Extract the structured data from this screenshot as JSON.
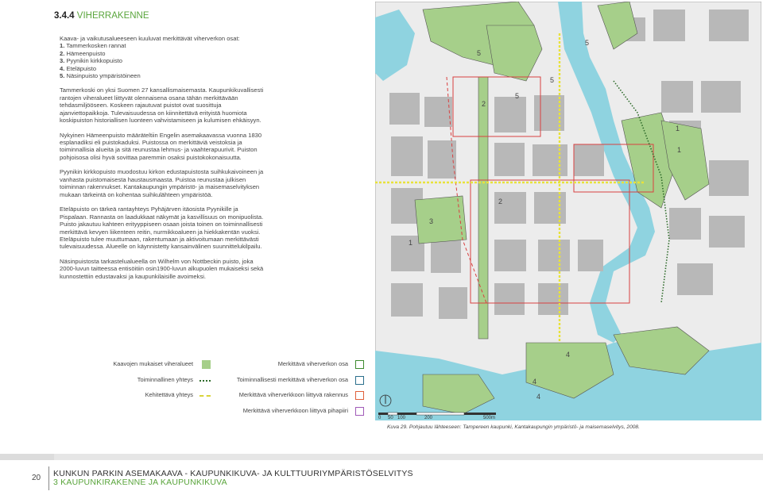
{
  "section": {
    "number": "3.4.4",
    "title": "VIHERRAKENNE"
  },
  "intro": "Kaava- ja vaikutusalueeseen kuuluvat merkittävät viherverkon osat:",
  "list": [
    {
      "num": "1.",
      "text": "Tammerkosken rannat"
    },
    {
      "num": "2.",
      "text": "Hämeenpuisto"
    },
    {
      "num": "3.",
      "text": "Pyynikin kirkkopuisto"
    },
    {
      "num": "4.",
      "text": "Eteläpuisto"
    },
    {
      "num": "5.",
      "text": "Näsinpuisto ympäristöineen"
    }
  ],
  "paragraphs": [
    "Tammerkoski on yksi Suomen 27 kansallismaisemasta. Kaupunkikuvallisesti rantojen viheralueet liittyvät olennaisena osana tähän merkittävään tehdasmiljööseen. Koskeen rajautuvat puistot ovat suosittuja ajanviettopaikkoja. Tulevaisuudessa on kiinnitettävä erityistä huomiota koskipuiston historiallisen luonteen vahvistamiseen ja kulumisen ehkäisyyn.",
    "Nykyinen Hämeenpuisto määräteltiin Engelin asemakaavassa vuonna 1830 esplanadiksi eli puistokaduksi. Puistossa on merkittäviä veistoksia ja toiminnallisia alueita ja sitä reunustaa lehmus- ja vaahterapuurivit. Puiston pohjoisosa olisi hyvä sovittaa paremmin osaksi puistokokonaisuutta.",
    "Pyynikin kirkkopuisto muodostuu kirkon edustapuistosta suihkukaivoineen ja vanhasta puistomaisesta haustausmaasta. Puistoa reunustaa julkisen toiminnan rakennukset. Kantakaupungin ympäristö- ja maisemaselvityksen mukaan tärkeintä on kohentaa suihkulähteen ympäristöä.",
    "Eteläpuisto on tärkeä rantayhteys Pyhäjärven itäosista Pyynikille ja Pispalaan. Rannasta on laadukkaat näkymät ja kasvillisuus on monipuolista. Puisto jakautuu kahteen erityyppiseen osaan joista toinen on toiminnallisesti merkittävä kevyen liikenteen reitin, nurmikkoalueen ja hiekkakentän vuoksi. Eteläpuisto tulee muuttumaan, rakentumaan ja aktivoitumaan merkittävästi tulevaisuudessa. Alueelle on käynnistetty kansainvälinen suunnittelukilpailu.",
    "Näsinpuistosta tarkastelualueella on Wilhelm von Nottbeckin puisto, joka 2000-luvun taitteessa entisöitiin osin1900-luvun alkupuolen mukaiseksi sekä kunnostettiin edustavaksi ja kaupunkilaisille avoimeksi."
  ],
  "legend": {
    "left": [
      {
        "label": "Kaavojen mukaiset viheralueet",
        "kind": "fill",
        "color": "#a6cf8a"
      },
      {
        "label": "Toiminnallinen yhteys",
        "kind": "dots",
        "color": "#2e6b2a"
      },
      {
        "label": "Kehitettävä yhteys",
        "kind": "dash",
        "color": "#d9d43a"
      }
    ],
    "right": [
      {
        "label": "Merkittävä viherverkon osa",
        "color": "#3c8a2e"
      },
      {
        "label": "Toiminnallisesti merkittävä viherverkon osa",
        "color": "#2a6f8c"
      },
      {
        "label": "Merkittävä viherverkkoon liittyvä rakennus",
        "color": "#e0603a"
      },
      {
        "label": "Merkittävä viherverkkoon liittyvä pihapiiri",
        "color": "#a05ab8"
      }
    ]
  },
  "map": {
    "area_numbers": [
      "5",
      "5",
      "5",
      "5",
      "2",
      "2",
      "1",
      "1",
      "1",
      "3",
      "4",
      "4",
      "4"
    ],
    "scale_labels": [
      "0",
      "50",
      "100",
      "200",
      "500m"
    ]
  },
  "caption": "Kuva 29. Pohjautuu lähteeseen: Tampereen kaupunki, Kantakaupungin ympäristö- ja maisemaselvitys, 2008.",
  "footer": {
    "page": "20",
    "line1": "KUNKUN PARKIN ASEMAKAAVA - KAUPUNKIKUVA- JA KULTTUURIYMPÄRISTÖSELVITYS",
    "line2": "3 KAUPUNKIRAKENNE JA KAUPUNKIKUVA"
  },
  "colors": {
    "accent_green": "#5aa53c",
    "water": "#8fd3e0",
    "green_area": "#a6cf8a",
    "building": "#b8b8b8",
    "red_line": "#d94040",
    "yellow_line": "#e8e23a"
  }
}
